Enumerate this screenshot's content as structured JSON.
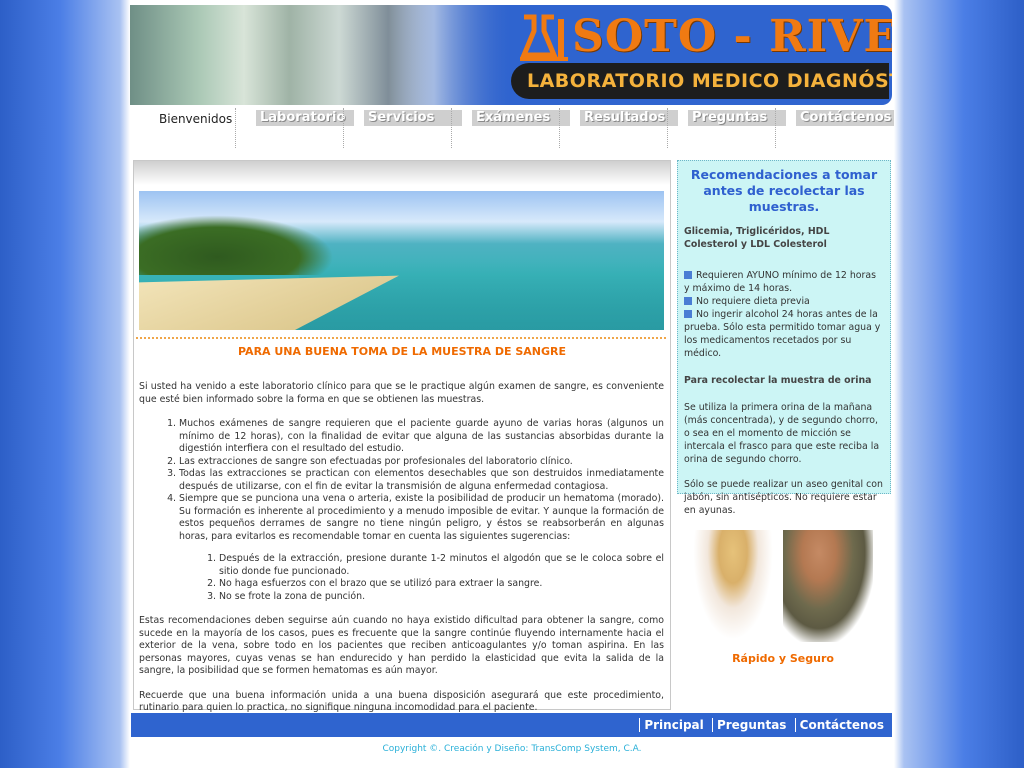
{
  "colors": {
    "brand_blue": "#2f64cf",
    "accent_orange": "#ef6a00",
    "panel_cyan": "#ccf5f5"
  },
  "header": {
    "logo_text": "SOTO - RIVERA",
    "subtitle": "LABORATORIO MEDICO DIAGNÓSTICO",
    "logo_icon": "flask-icon"
  },
  "nav": {
    "home": "Bienvenidos",
    "items": [
      "Laboratorio",
      "Servicios",
      "Exámenes",
      "Resultados",
      "Preguntas",
      "Contáctenos"
    ]
  },
  "main": {
    "section_title": "PARA UNA BUENA TOMA DE LA MUESTRA DE SANGRE",
    "intro": "Si usted ha venido a este laboratorio clínico para que se le practique algún examen de sangre, es conveniente que esté bien informado sobre la forma en que se obtienen las muestras.",
    "list": [
      "Muchos exámenes de sangre requieren que el paciente guarde ayuno de varias horas (algunos un mínimo de 12 horas), con la finalidad de evitar que alguna de las sustancias absorbidas durante la digestión interfiera con el resultado del estudio.",
      "Las extracciones de sangre son efectuadas por profesionales del laboratorio clínico.",
      "Todas las extracciones se practican con elementos desechables que son destruidos inmediatamente después de utilizarse, con el fin de evitar la transmisión de alguna enfermedad contagiosa.",
      "Siempre que se punciona una vena o arteria, existe la posibilidad de producir un hematoma (morado). Su formación es inherente al procedimiento y a menudo imposible de evitar. Y aunque la formación de estos pequeños derrames de sangre no tiene ningún peligro, y éstos se reabsorberán en algunas horas, para evitarlos es recomendable tomar en cuenta las siguientes sugerencias:"
    ],
    "sublist": [
      "Después de la extracción, presione durante 1-2 minutos el algodón que se le coloca sobre el sitio donde fue puncionado.",
      "No haga esfuerzos con el brazo que se utilizó para extraer la sangre.",
      "No se frote la zona de punción."
    ],
    "paragraph2": "Estas recomendaciones deben seguirse aún cuando no haya existido dificultad para obtener la sangre, como sucede en la mayoría de los casos, pues es frecuente que la sangre continúe fluyendo internamente hacia el exterior de la vena, sobre todo en los pacientes que reciben anticoagulantes y/o toman aspirina. En las personas mayores, cuyas venas se han endurecido y han perdido la elasticidad que evita la salida de la sangre, la posibilidad que se formen hematomas es aún mayor.",
    "paragraph3": "Recuerde que una buena información unida a una buena disposición asegurará que este procedimiento, rutinario para quien lo practica, no signifique ninguna incomodidad para el paciente."
  },
  "sidebar": {
    "title": "Recomendaciones a tomar antes de recolectar las muestras.",
    "subhead1": "Glicemia, Triglicéridos, HDL Colesterol y LDL Colesterol",
    "bullets": [
      "Requieren AYUNO mínimo de 12 horas y máximo de 14 horas.",
      "No requiere dieta previa",
      "No ingerir alcohol 24 horas antes de la prueba. Sólo esta permitido tomar agua y los medicamentos recetados por su médico."
    ],
    "subhead2": "Para recolectar la muestra de orina",
    "p1": "Se utiliza la primera orina de la mañana (más concentrada), y de segundo chorro, o sea en el momento de micción se intercala el frasco para que este reciba la orina de segundo chorro.",
    "p2": "Sólo se puede realizar un aseo genital con jabón, sin antisépticos. No requiere estar en ayunas.",
    "caption": "Rápido y Seguro"
  },
  "footer": {
    "links": [
      "Principal",
      "Preguntas",
      "Contáctenos"
    ],
    "copyright": "Copyright ©. Creación y Diseño: TransComp System, C.A."
  }
}
